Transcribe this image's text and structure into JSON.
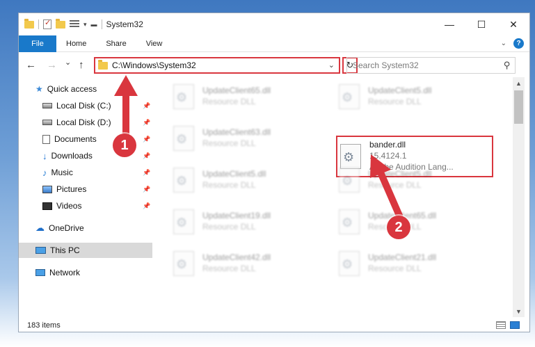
{
  "window": {
    "title": "System32",
    "controls": {
      "minimize": "—",
      "maximize": "☐",
      "close": "✕"
    }
  },
  "ribbon": {
    "tabs": [
      "File",
      "Home",
      "Share",
      "View"
    ],
    "help": "?"
  },
  "nav": {
    "back": "←",
    "forward": "→",
    "recent": "⌄",
    "up": "↑",
    "address": "C:\\Windows\\System32",
    "search_placeholder": "Search System32"
  },
  "sidebar": {
    "items": [
      {
        "label": "Quick access",
        "icon": "star-icon",
        "pinned": false
      },
      {
        "label": "Local Disk (C:)",
        "icon": "disk-icon",
        "pinned": true
      },
      {
        "label": "Local Disk (D:)",
        "icon": "disk-icon",
        "pinned": true
      },
      {
        "label": "Documents",
        "icon": "document-icon",
        "pinned": true
      },
      {
        "label": "Downloads",
        "icon": "download-icon",
        "pinned": true
      },
      {
        "label": "Music",
        "icon": "music-icon",
        "pinned": true
      },
      {
        "label": "Pictures",
        "icon": "pictures-icon",
        "pinned": true
      },
      {
        "label": "Videos",
        "icon": "videos-icon",
        "pinned": true
      },
      {
        "label": "OneDrive",
        "icon": "cloud-icon",
        "pinned": false
      },
      {
        "label": "This PC",
        "icon": "computer-icon",
        "pinned": false,
        "selected": true
      },
      {
        "label": "Network",
        "icon": "network-icon",
        "pinned": false
      }
    ]
  },
  "files": [
    {
      "name": "UpdateClient65.dll",
      "sub": "Resource DLL",
      "blurred": true
    },
    {
      "name": "UpdateClient5.dll",
      "sub": "Resource DLL",
      "blurred": true
    },
    {
      "name": "UpdateClient63.dll",
      "sub": "Resource DLL",
      "blurred": true
    },
    {
      "name": "bander.dll",
      "version": "15.4124.1",
      "description": "Adobe Audition Lang...",
      "blurred": false,
      "highlighted": true
    },
    {
      "name": "UpdateClient5.dll",
      "sub": "Resource DLL",
      "blurred": true
    },
    {
      "name": "UpdateClient5.dll",
      "sub": "Resource DLL",
      "blurred": true
    },
    {
      "name": "UpdateClient19.dll",
      "sub": "Resource DLL",
      "blurred": true
    },
    {
      "name": "UpdateClient65.dll",
      "sub": "Resource DLL",
      "blurred": true
    },
    {
      "name": "UpdateClient42.dll",
      "sub": "Resource DLL",
      "blurred": true
    },
    {
      "name": "UpdateClient21.dll",
      "sub": "Resource DLL",
      "blurred": true
    }
  ],
  "status": {
    "count": "183 items"
  },
  "annotations": {
    "step1": "1",
    "step2": "2",
    "color": "#d9363e"
  }
}
